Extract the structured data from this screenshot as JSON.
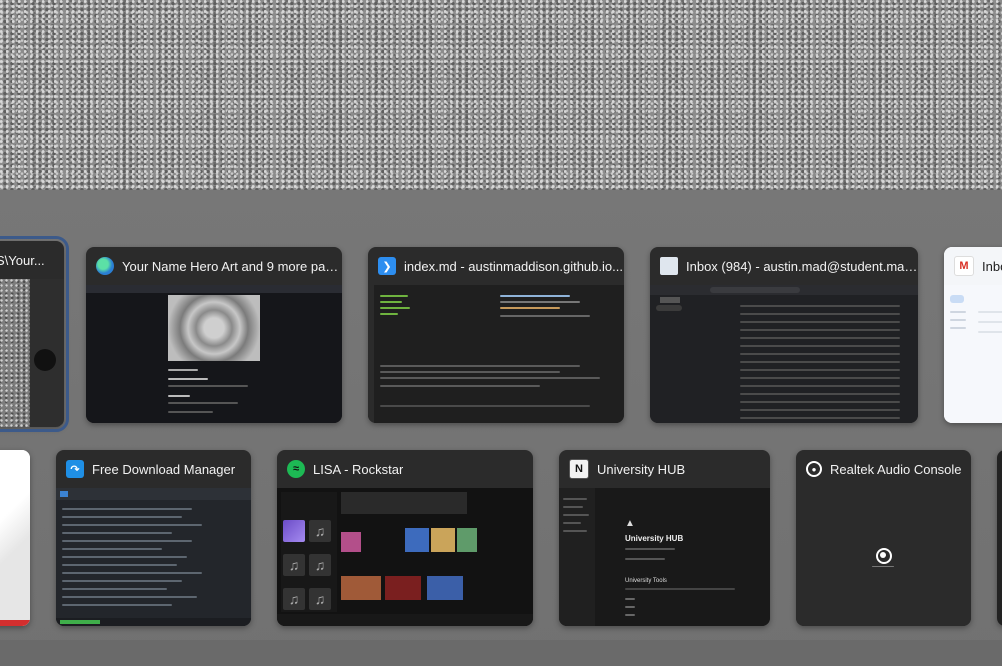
{
  "task_switcher": {
    "row1": [
      {
        "title": "S\\Your...",
        "icon": "photo-editor-icon",
        "selected": true
      },
      {
        "title": "Your Name Hero Art and 9 more pag...",
        "icon": "edge-icon"
      },
      {
        "title": "index.md - austinmaddison.github.io...",
        "icon": "vscode-icon"
      },
      {
        "title": "Inbox (984) - austin.mad@student.mah...",
        "icon": "mail-window-icon"
      },
      {
        "title": "Inbo",
        "icon": "gmail-icon"
      }
    ],
    "row2": [
      {
        "title": "",
        "icon": "blank-icon"
      },
      {
        "title": "Free Download Manager",
        "icon": "fdm-icon"
      },
      {
        "title": "LISA - Rockstar",
        "icon": "spotify-icon"
      },
      {
        "title": "University HUB",
        "icon": "notion-icon"
      },
      {
        "title": "Realtek Audio Console",
        "icon": "realtek-icon"
      }
    ]
  },
  "thumbs": {
    "notion_page_title": "University HUB",
    "notion_sub": "University Tools"
  },
  "colors": {
    "selection_outline": "#3c5a8a",
    "card_bg": "#2b2b2b",
    "overlay": "#737373",
    "vscode_blue": "#2d8ef0",
    "spotify_green": "#1db954",
    "gmail_red": "#d93025"
  }
}
